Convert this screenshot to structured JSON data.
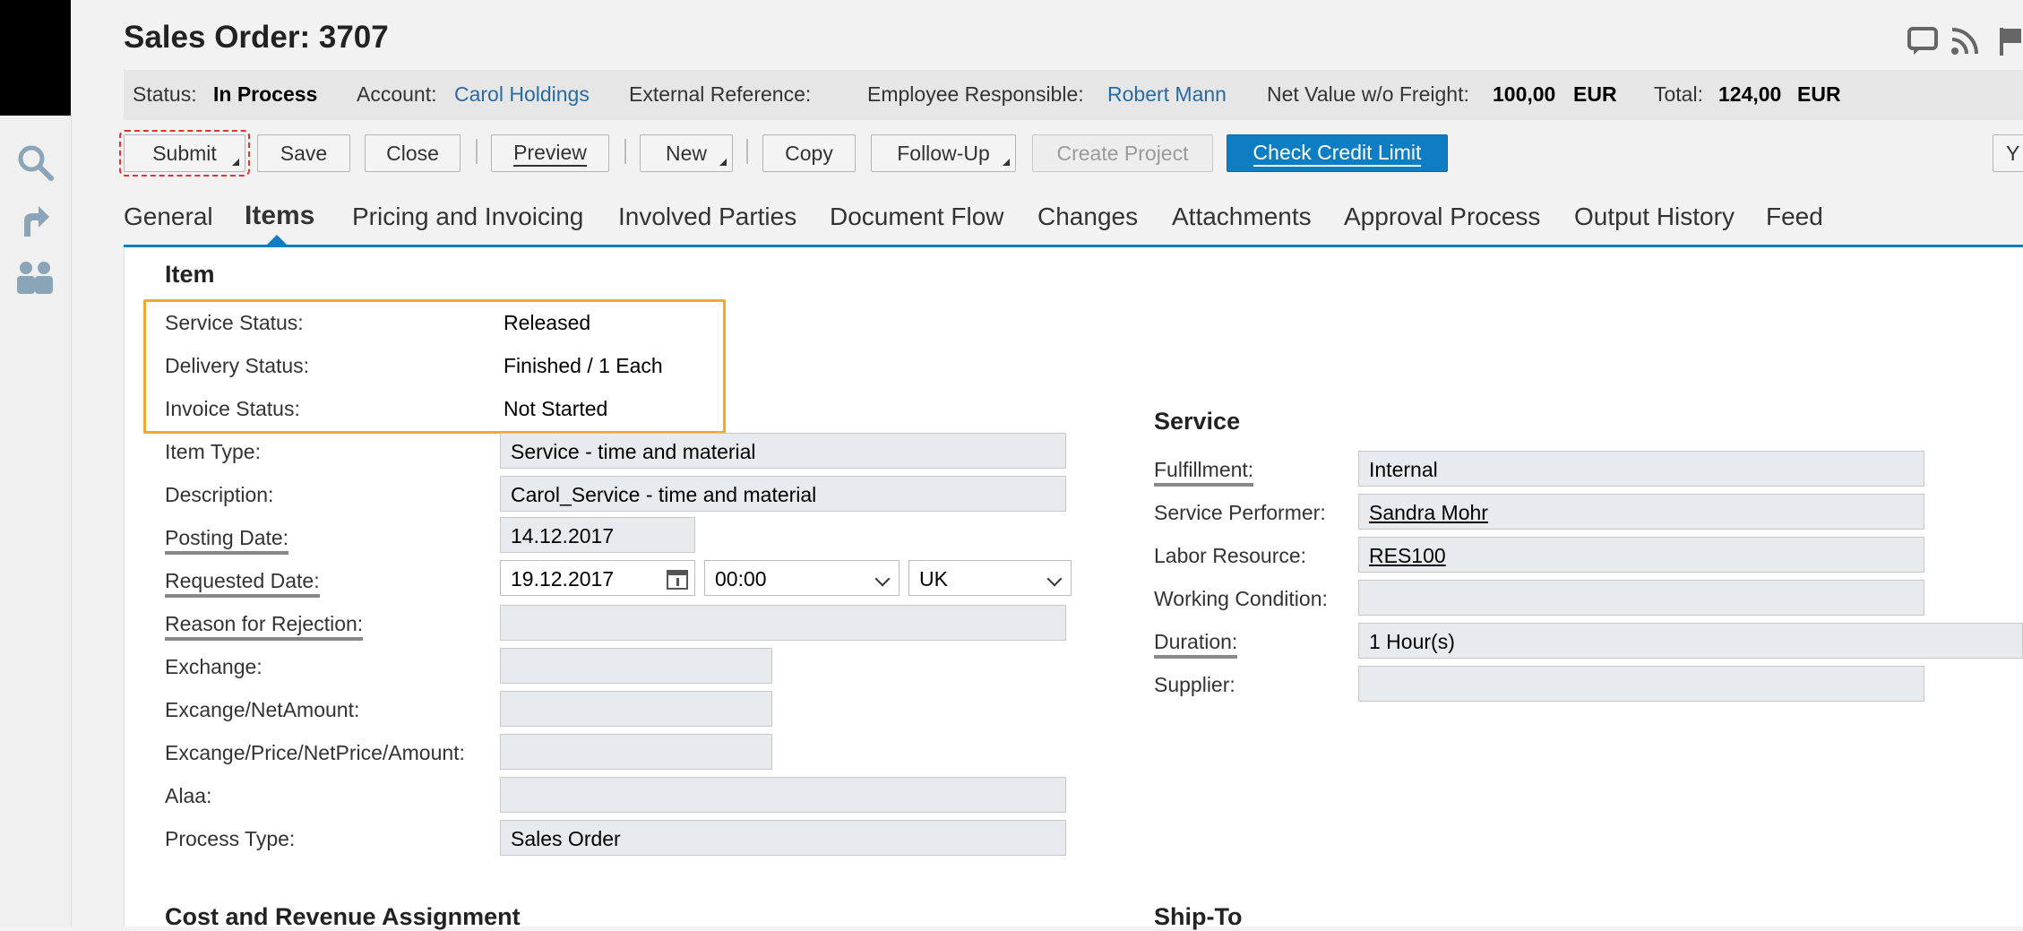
{
  "header": {
    "title": "Sales Order: 3707"
  },
  "status_bar": {
    "status_label": "Status:",
    "status_value": "In Process",
    "account_label": "Account:",
    "account_value": "Carol Holdings",
    "extref_label": "External Reference:",
    "employee_label": "Employee Responsible:",
    "employee_value": "Robert Mann",
    "netvalue_label": "Net Value w/o Freight:",
    "netvalue_value": "100,00",
    "netvalue_currency": "EUR",
    "total_label": "Total:",
    "total_value": "124,00",
    "total_currency": "EUR"
  },
  "toolbar": {
    "submit": "Submit",
    "save": "Save",
    "close": "Close",
    "preview": "Preview",
    "new": "New",
    "copy": "Copy",
    "followup": "Follow-Up",
    "create_project": "Create Project",
    "check_credit": "Check Credit Limit",
    "overflow": "Y"
  },
  "tabs": [
    "General",
    "Items",
    "Pricing and Invoicing",
    "Involved Parties",
    "Document Flow",
    "Changes",
    "Attachments",
    "Approval Process",
    "Output History",
    "Feed"
  ],
  "item": {
    "heading": "Item",
    "service_status_label": "Service Status:",
    "service_status": "Released",
    "delivery_status_label": "Delivery Status:",
    "delivery_status": "Finished / 1 Each",
    "invoice_status_label": "Invoice Status:",
    "invoice_status": "Not Started",
    "item_type_label": "Item Type:",
    "item_type": "Service - time and material",
    "description_label": "Description:",
    "description": "Carol_Service - time and material",
    "posting_date_label": "Posting Date:",
    "posting_date": "14.12.2017",
    "requested_date_label": "Requested Date:",
    "requested_date": "19.12.2017",
    "requested_time": "00:00",
    "requested_tz": "UK",
    "rejection_label": "Reason for Rejection:",
    "rejection": "",
    "exchange_label": "Exchange:",
    "exchange": "",
    "excange_net_label": "Excange/NetAmount:",
    "excange_net": "",
    "excange_price_label": "Excange/Price/NetPrice/Amount:",
    "excange_price": "",
    "alaa_label": "Alaa:",
    "alaa": "",
    "process_type_label": "Process Type:",
    "process_type": "Sales Order"
  },
  "service": {
    "heading": "Service",
    "fulfillment_label": "Fulfillment:",
    "fulfillment": "Internal",
    "performer_label": "Service Performer:",
    "performer": "Sandra Mohr",
    "labor_label": "Labor Resource:",
    "labor": "RES100",
    "working_label": "Working Condition:",
    "working": "",
    "duration_label": "Duration:",
    "duration": "1 Hour(s)",
    "supplier_label": "Supplier:",
    "supplier": ""
  },
  "footer_sections": {
    "cost_revenue": "Cost and Revenue Assignment",
    "ship_to": "Ship-To"
  },
  "colors": {
    "accent": "#0f7dc2",
    "highlight": "#f0a830",
    "link": "#2a6aa3"
  }
}
